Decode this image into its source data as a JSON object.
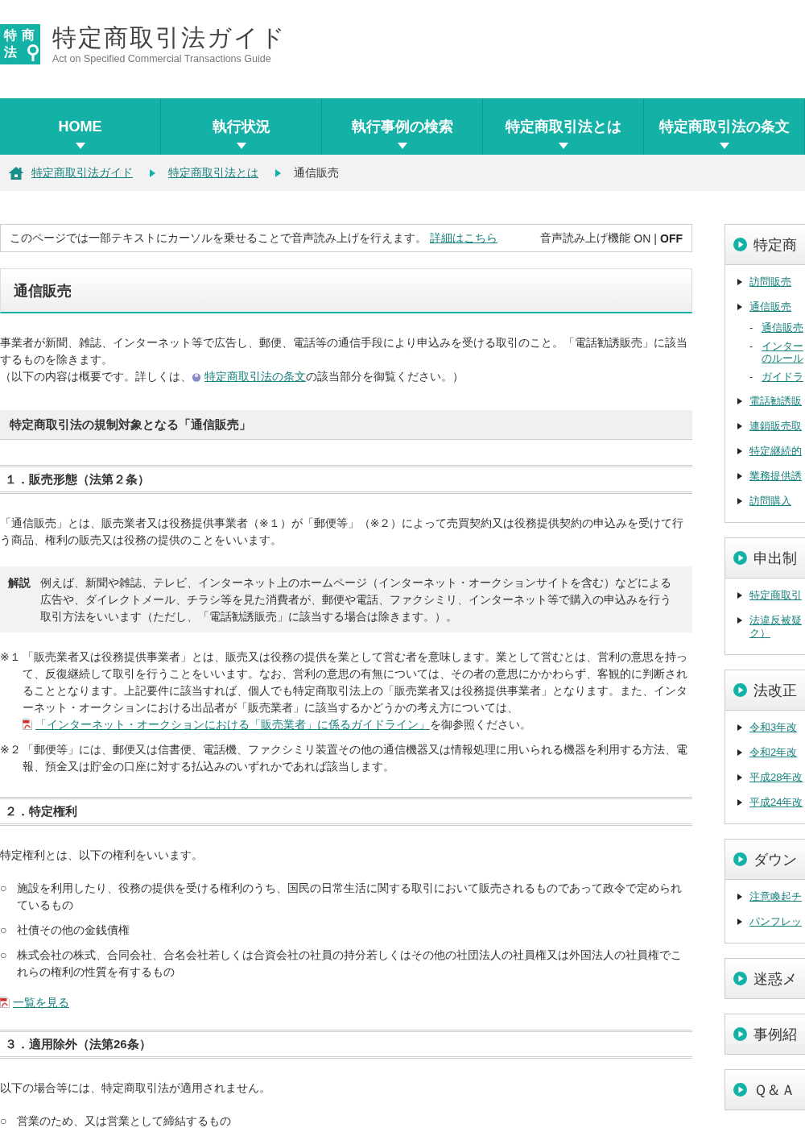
{
  "header": {
    "logo_mark": [
      "特商",
      "法"
    ],
    "title": "特定商取引法ガイド",
    "subtitle": "Act on Specified Commercial Transactions Guide"
  },
  "nav": [
    {
      "label": "HOME"
    },
    {
      "label": "執行状況"
    },
    {
      "label": "執行事例の検索"
    },
    {
      "label": "特定商取引法とは"
    },
    {
      "label": "特定商取引法の条文"
    }
  ],
  "breadcrumb": [
    {
      "kind": "link",
      "label": "特定商取引法ガイド"
    },
    {
      "kind": "link",
      "label": "特定商取引法とは"
    },
    {
      "kind": "current",
      "label": "通信販売"
    }
  ],
  "notice": {
    "text": "このページでは一部テキストにカーソルを乗せることで音声読み上げを行えます。",
    "link": "詳細はこちら",
    "speech_toggle": {
      "label": "音声読み上げ機能",
      "separator": "|",
      "options": [
        {
          "label": "ON",
          "selected": false
        },
        {
          "label": "OFF",
          "selected": true
        }
      ]
    }
  },
  "page_title": "通信販売",
  "content": [
    {
      "kind": "paragraph",
      "lines": [
        [
          {
            "kind": "text",
            "text": "事業者が新聞、雑誌、インターネット等で広告し、郵便、電話等の通信手段により申込みを受ける取引のこと。「電話勧誘販売」に該当するものを除きます。"
          }
        ],
        [
          {
            "kind": "text",
            "text": "（以下の内容は概要です。詳しくは、"
          },
          {
            "kind": "law_link",
            "text": "特定商取引法の条文"
          },
          {
            "kind": "text",
            "text": "の該当部分を御覧ください。）"
          }
        ]
      ]
    },
    {
      "kind": "heading2",
      "text": "特定商取引法の規制対象となる「通信販売」"
    },
    {
      "kind": "heading3",
      "text": "１．販売形態（法第２条）"
    },
    {
      "kind": "paragraph",
      "lines": [
        [
          {
            "kind": "text",
            "text": "「通信販売」とは、販売業者又は役務提供事業者（※１）が「郵便等」（※２）によって売買契約又は役務提供契約の申込みを受けて行う商品、権利の販売又は役務の提供のことをいいます。"
          }
        ]
      ]
    },
    {
      "kind": "explanation",
      "label": "解説",
      "text": "例えば、新聞や雑誌、テレビ、インターネット上のホームページ（インターネット・オークションサイトを含む）などによる広告や、ダイレクトメール、チラシ等を見た消費者が、郵便や電話、ファクシミリ、インターネット等で購入の申込みを行う取引方法をいいます（ただし、「電話勧誘販売」に該当する場合は除きます。）。"
    },
    {
      "kind": "notes",
      "items": [
        {
          "mark": "※１",
          "parts": [
            {
              "kind": "text",
              "text": "「販売業者又は役務提供事業者」とは、販売又は役務の提供を業として営む者を意味します。業として営むとは、営利の意思を持って、反復継続して取引を行うことをいいます。なお、営利の意思の有無については、その者の意思にかかわらず、客観的に判断されることとなります。上記要件に該当すれば、個人でも特定商取引法上の「販売業者又は役務提供事業者」となります。また、インターネット・オークションにおける出品者が「販売業者」に該当するかどうかの考え方については、"
            },
            {
              "kind": "pdf_link",
              "text": "「インターネット・オークションにおける「販売業者」に係るガイドライン」"
            },
            {
              "kind": "text",
              "text": "を御参照ください。"
            }
          ]
        },
        {
          "mark": "※２",
          "parts": [
            {
              "kind": "text",
              "text": "「郵便等」には、郵便又は信書便、電話機、ファクシミリ装置その他の通信機器又は情報処理に用いられる機器を利用する方法、電報、預金又は貯金の口座に対する払込みのいずれかであれば該当します。"
            }
          ]
        }
      ]
    },
    {
      "kind": "heading3",
      "text": "２．特定権利"
    },
    {
      "kind": "paragraph",
      "lines": [
        [
          {
            "kind": "text",
            "text": "特定権利とは、以下の権利をいいます。"
          }
        ]
      ]
    },
    {
      "kind": "list",
      "marker": "○",
      "items": [
        "施設を利用したり、役務の提供を受ける権利のうち、国民の日常生活に関する取引において販売されるものであって政令で定められているもの",
        "社債その他の金銭債権",
        "株式会社の株式、合同会社、合名会社若しくは合資会社の社員の持分若しくはその他の社団法人の社員権又は外国法人の社員権でこれらの権利の性質を有するもの"
      ]
    },
    {
      "kind": "link_line",
      "parts": [
        {
          "kind": "pdf_link",
          "text": "一覧を見る"
        }
      ]
    },
    {
      "kind": "heading3",
      "text": "３．適用除外（法第26条）"
    },
    {
      "kind": "paragraph",
      "lines": [
        [
          {
            "kind": "text",
            "text": "以下の場合等には、特定商取引法が適用されません。"
          }
        ]
      ]
    },
    {
      "kind": "list",
      "marker": "○",
      "items": [
        "営業のため、又は営業として締結するもの"
      ]
    }
  ],
  "sidebar": [
    {
      "title": "特定商",
      "items": [
        {
          "lines": [
            "訪問販売"
          ]
        },
        {
          "lines": [
            "通信販売"
          ],
          "children": [
            {
              "marker": "-",
              "lines": [
                "通信販売"
              ]
            },
            {
              "marker": "-",
              "lines": [
                "インター",
                "のルール"
              ]
            },
            {
              "marker": "-",
              "lines": [
                "ガイドラ"
              ]
            }
          ]
        },
        {
          "lines": [
            "電話勧誘販"
          ]
        },
        {
          "lines": [
            "連鎖販売取"
          ]
        },
        {
          "lines": [
            "特定継続的"
          ]
        },
        {
          "lines": [
            "業務提供誘"
          ]
        },
        {
          "lines": [
            "訪問購入"
          ]
        }
      ]
    },
    {
      "title": "申出制",
      "items": [
        {
          "lines": [
            "特定商取引"
          ]
        },
        {
          "lines": [
            "法違反被疑",
            "ク）"
          ]
        }
      ]
    },
    {
      "title": "法改正",
      "items": [
        {
          "lines": [
            "令和3年改"
          ]
        },
        {
          "lines": [
            "令和2年改"
          ]
        },
        {
          "lines": [
            "平成28年改"
          ]
        },
        {
          "lines": [
            "平成24年改"
          ]
        }
      ]
    },
    {
      "title": "ダウン",
      "items": [
        {
          "lines": [
            "注意喚起チ"
          ]
        },
        {
          "lines": [
            "パンフレッ"
          ]
        }
      ]
    },
    {
      "title": "迷惑メ"
    },
    {
      "title": "事例紹"
    },
    {
      "title": "Ｑ＆Ａ"
    }
  ]
}
